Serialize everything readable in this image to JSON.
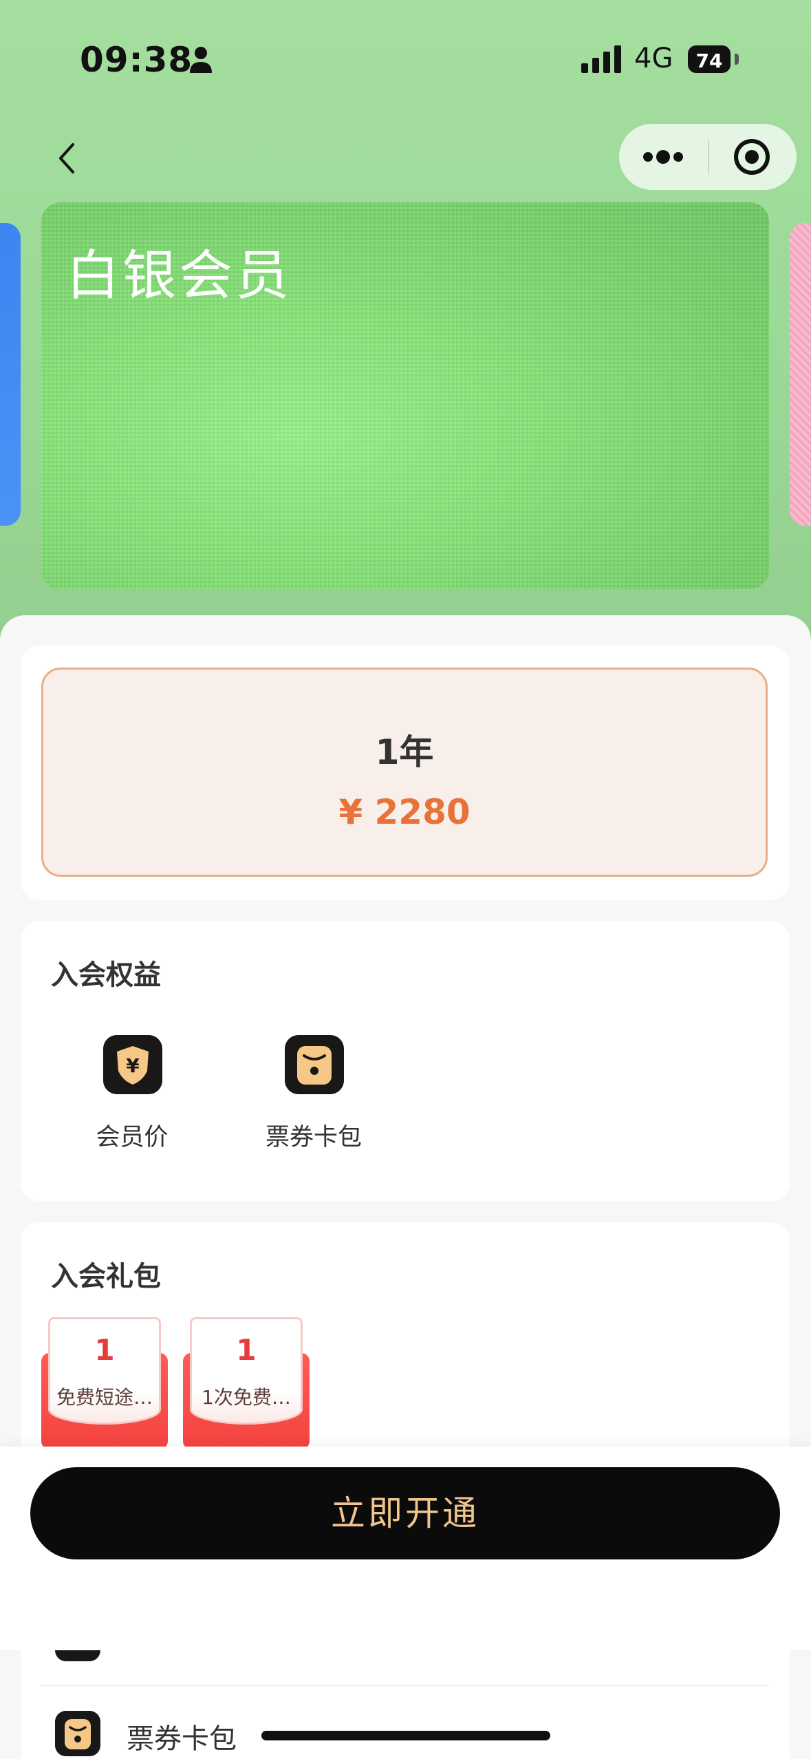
{
  "status_bar": {
    "time": "09:38",
    "network": "4G",
    "battery": "74",
    "icons": [
      "person-icon",
      "signal-icon",
      "battery-icon"
    ]
  },
  "nav": {
    "back_icon": "chevron-left-icon",
    "more_icon": "more-dots-icon",
    "close_icon": "target-circle-icon"
  },
  "membership_card": {
    "title": "白银会员",
    "color_prev": "#3d85f0",
    "color_current": "#86e277",
    "color_next": "#f3a6be"
  },
  "plan": {
    "duration": "1年",
    "price": "¥ 2280",
    "accent_color": "#e8733a",
    "selected": true
  },
  "benefits": {
    "title": "入会权益",
    "items": [
      {
        "label": "会员价",
        "icon": "yen-shield-icon"
      },
      {
        "label": "票券卡包",
        "icon": "ticket-wallet-icon"
      }
    ]
  },
  "gift_pack": {
    "title": "入会礼包",
    "items": [
      {
        "count": "1",
        "name": "免费短途…"
      },
      {
        "count": "1",
        "name": "1次免费…"
      }
    ]
  },
  "action": {
    "open_label": "立即开通",
    "button_color": "#0b0b0b",
    "text_color": "#f1c48e"
  },
  "lower_list": {
    "items": [
      {
        "label": "票券卡包",
        "icon": "ticket-wallet-icon"
      }
    ]
  }
}
